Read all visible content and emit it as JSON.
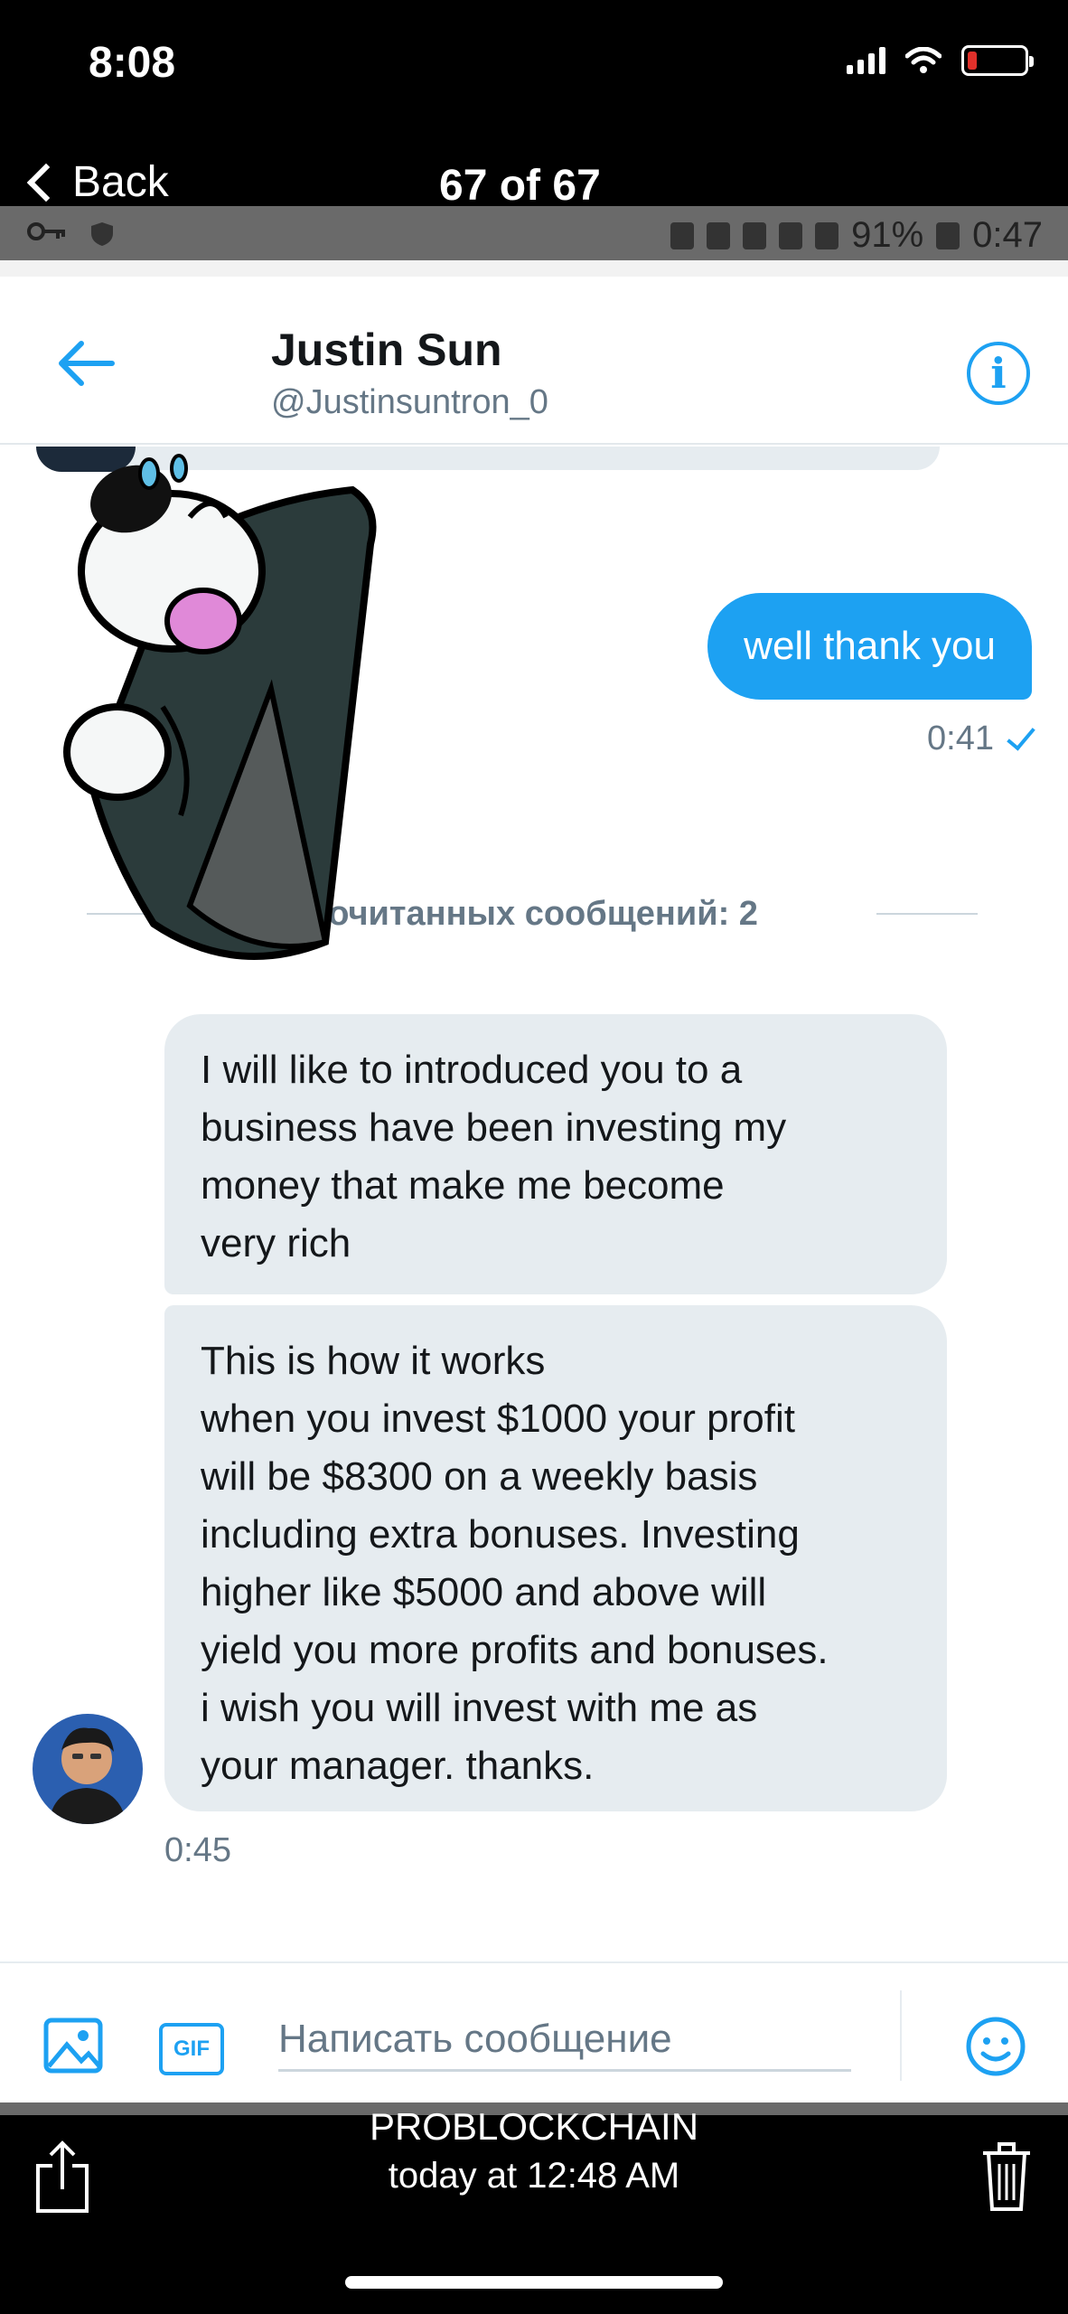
{
  "ios_status": {
    "time": "8:08"
  },
  "viewer": {
    "back_label": "Back",
    "count": "67 of 67",
    "sender": "PROBLOCKCHAIN",
    "timestamp": "today at 12:48 AM"
  },
  "android_status": {
    "battery": "91%",
    "time": "0:47"
  },
  "header": {
    "name": "Justin Sun",
    "handle": "@Justinsuntron_0"
  },
  "messages": {
    "sent": {
      "text": "well thank you",
      "time": "0:41"
    },
    "unread_divider": "рочитанных сообщений: 2",
    "received": [
      {
        "lines": [
          "I will like to introduced you to a",
          "business have been investing my",
          "money that make me become",
          "very rich"
        ]
      },
      {
        "lines": [
          "This is how it works",
          "when you invest $1000 your profit",
          "will be $8300 on a weekly basis",
          "including extra bonuses. Investing",
          "higher like $5000 and above will",
          "yield you more profits and bonuses.",
          "i wish you will invest with me as",
          "your manager. thanks."
        ]
      }
    ],
    "received_time": "0:45"
  },
  "compose": {
    "placeholder": "Написать сообщение",
    "gif_label": "GIF"
  },
  "colors": {
    "accent": "#1da1f2",
    "bubble_received": "#e6ecf0",
    "text_secondary": "#657786"
  },
  "icons": [
    "back-arrow-icon",
    "info-icon",
    "image-icon",
    "gif-icon",
    "emoji-icon",
    "share-icon",
    "trash-icon"
  ]
}
